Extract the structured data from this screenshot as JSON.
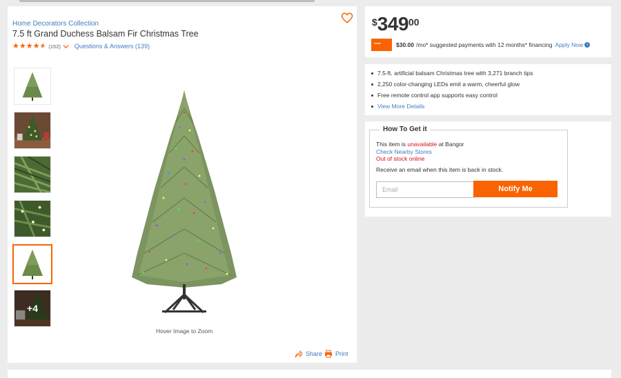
{
  "product": {
    "brand": "Home Decorators Collection",
    "title": "7.5 ft Grand Duchess Balsam Fir Christmas Tree",
    "rating": 4.5,
    "review_count": "(152)",
    "qa_link": "Questions & Answers (139)"
  },
  "gallery": {
    "thumbnails": [
      {
        "kind": "tree-white"
      },
      {
        "kind": "room-scene"
      },
      {
        "kind": "branch-closeup"
      },
      {
        "kind": "lights-closeup"
      },
      {
        "kind": "tree-white",
        "selected": true
      },
      {
        "kind": "room-scene",
        "overlay": "+4"
      }
    ],
    "zoom_hint": "Hover Image to Zoom",
    "share_label": "Share",
    "print_label": "Print"
  },
  "pricing": {
    "currency": "$",
    "dollars": "349",
    "cents": "00",
    "financing_amount": "$30.00",
    "financing_text": "/mo* suggested payments with 12 months* financing",
    "apply_label": "Apply Now"
  },
  "highlights": [
    "7.5-ft. artificial balsam Christmas tree with 3,271 branch tips",
    "2,250 color-changing LEDs emit a warm, cheerful glow",
    "Free remote control app supports easy control"
  ],
  "highlights_link": "View More Details",
  "fulfillment": {
    "heading": "How To Get it",
    "avail_prefix": "This item is ",
    "avail_status": "unavailable",
    "avail_suffix": " at Bangor",
    "nearby_link": "Check Nearby Stores",
    "online_status": "Out of stock online",
    "notify_text": "Receive an email when this item is back in stock.",
    "email_placeholder": "Email",
    "notify_button": "Notify Me"
  },
  "colors": {
    "brand_orange": "#f96302",
    "link_blue": "#3e7dc0",
    "alert_red": "#d81118"
  }
}
